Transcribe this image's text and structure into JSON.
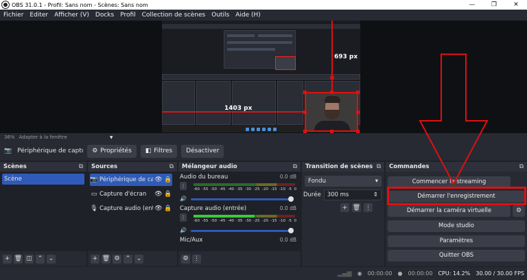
{
  "window": {
    "title": "OBS 31.0.1 - Profil: Sans nom - Scènes: Sans nom",
    "minimize": "—",
    "maximize": "❐",
    "close": "✕"
  },
  "menu": [
    "Fichier",
    "Editer",
    "Afficher (V)",
    "Docks",
    "Profil",
    "Collection de scènes",
    "Outils",
    "Aide (H)"
  ],
  "preview": {
    "label_width": "1403 px",
    "label_height": "693 px"
  },
  "zoom": {
    "percent": "36%",
    "mode": "Adapter à la fenêtre"
  },
  "source_toolbar": {
    "source_name": "Périphérique de capture vi",
    "properties": "Propriétés",
    "filters": "Filtres",
    "deactivate": "Désactiver"
  },
  "scenes": {
    "title": "Scènes",
    "items": [
      "Scène"
    ]
  },
  "sources": {
    "title": "Sources",
    "items": [
      {
        "name": "Périphérique de capt",
        "icon": "camera-icon",
        "selected": true
      },
      {
        "name": "Capture d'écran",
        "icon": "monitor-icon",
        "selected": false
      },
      {
        "name": "Capture audio (entré",
        "icon": "microphone-icon",
        "selected": false
      }
    ]
  },
  "mixer": {
    "title": "Mélangeur audio",
    "channels": [
      {
        "name": "Audio du bureau",
        "db": "0.0 dB",
        "level": 0.0
      },
      {
        "name": "Capture audio (entrée)",
        "db": "0.0 dB",
        "level": 0.6
      },
      {
        "name": "Mic/Aux",
        "db": "0.0 dB",
        "level": 0.0
      }
    ],
    "scale": [
      "-60",
      "-55",
      "-50",
      "-45",
      "-40",
      "-35",
      "-30",
      "-25",
      "-20",
      "-15",
      "-10",
      "-5",
      "0"
    ]
  },
  "transitions": {
    "title": "Transition de scènes",
    "type": "Fondu",
    "duration_label": "Durée",
    "duration": "300 ms"
  },
  "controls": {
    "title": "Commandes",
    "buttons": {
      "stream": "Commencer le streaming",
      "record": "Démarrer l'enregistrement",
      "virtualcam": "Démarrer la caméra virtuelle",
      "studio": "Mode studio",
      "settings": "Paramètres",
      "exit": "Quitter OBS"
    }
  },
  "status": {
    "stream_time": "00:00:00",
    "record_time": "00:00:00",
    "cpu": "CPU: 14.2%",
    "fps": "30.00 / 30.00 FPS"
  },
  "colors": {
    "accent": "#2f5ab8",
    "highlight": "#e01010"
  }
}
